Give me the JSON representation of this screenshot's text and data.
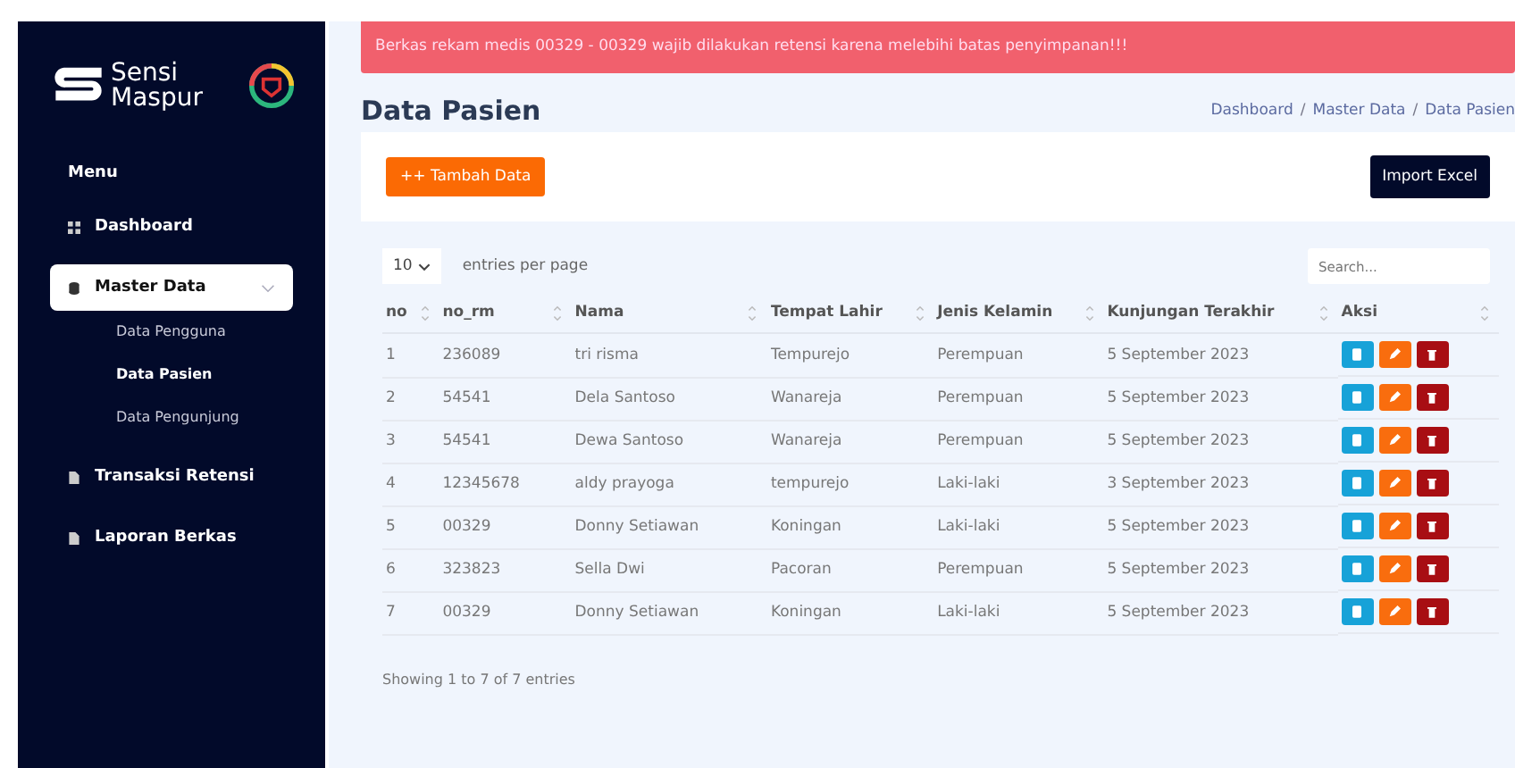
{
  "brand": {
    "line_1": "Sensi",
    "line_2": "Maspur"
  },
  "alert": {
    "text": "Berkas rekam medis 00329 - 00329 wajib dilakukan retensi karena melebihi batas penyimpanan!!!"
  },
  "sidebar": {
    "heading": "Menu",
    "items": [
      {
        "label": "Dashboard",
        "kind": "grid",
        "selected": false
      },
      {
        "label": "Master Data",
        "kind": "database",
        "selected": true,
        "expanded": true,
        "children": [
          {
            "label": "Data Pengguna",
            "selected": false
          },
          {
            "label": "Data Pasien",
            "selected": true
          },
          {
            "label": "Data Pengunjung",
            "selected": false
          }
        ]
      },
      {
        "label": "Transaksi Retensi",
        "kind": "file",
        "selected": false
      },
      {
        "label": "Laporan Berkas",
        "kind": "file",
        "selected": false
      }
    ]
  },
  "page": {
    "title": "Data Pasien",
    "breadcrumb_separator": "/",
    "breadcrumb": [
      "Dashboard",
      "Master Data",
      "Data Pasien"
    ]
  },
  "toolbar": {
    "add_button": "++ Tambah Data",
    "import_button": "Import Excel"
  },
  "table": {
    "page_size": "10",
    "entries_label": "entries per page",
    "search": {
      "placeholder": "Search..."
    },
    "columns": [
      "no",
      "no_rm",
      "Nama",
      "Tempat Lahir",
      "Jenis Kelamin",
      "Kunjungan Terakhir",
      "Aksi"
    ],
    "rows": [
      [
        "1",
        "236089",
        "tri risma",
        "Tempurejo",
        "Perempuan",
        "5 September 2023"
      ],
      [
        "2",
        "54541",
        "Dela Santoso",
        "Wanareja",
        "Perempuan",
        "5 September 2023"
      ],
      [
        "3",
        "54541",
        "Dewa Santoso",
        "Wanareja",
        "Perempuan",
        "5 September 2023"
      ],
      [
        "4",
        "12345678",
        "aldy prayoga",
        "tempurejo",
        "Laki-laki",
        "3 September 2023"
      ],
      [
        "5",
        "00329",
        "Donny Setiawan",
        "Koningan",
        "Laki-laki",
        "5 September 2023"
      ],
      [
        "6",
        "323823",
        "Sella Dwi",
        "Pacoran",
        "Perempuan",
        "5 September 2023"
      ],
      [
        "7",
        "00329",
        "Donny Setiawan",
        "Koningan",
        "Laki-laki",
        "5 September 2023"
      ]
    ],
    "footer": "Showing 1 to 7 of 7 entries"
  }
}
